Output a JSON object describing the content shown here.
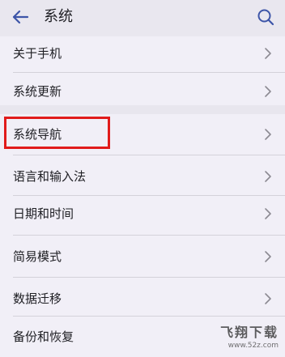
{
  "header": {
    "title": "系统",
    "back_icon": "back-arrow-icon",
    "search_icon": "search-icon",
    "accent_color": "#3d55a8"
  },
  "menu": {
    "groups": [
      {
        "items": [
          {
            "label": "关于手机",
            "icon": "chevron-right-icon"
          },
          {
            "label": "系统更新",
            "icon": "chevron-right-icon"
          }
        ]
      },
      {
        "items": [
          {
            "label": "系统导航",
            "icon": "chevron-right-icon",
            "highlighted": true
          },
          {
            "label": "语言和输入法",
            "icon": "chevron-right-icon"
          },
          {
            "label": "日期和时间",
            "icon": "chevron-right-icon"
          },
          {
            "label": "简易模式",
            "icon": "chevron-right-icon"
          },
          {
            "label": "数据迁移",
            "icon": "chevron-right-icon"
          },
          {
            "label": "备份和恢复",
            "icon": "chevron-right-icon"
          }
        ]
      }
    ]
  },
  "annotation": {
    "highlight_color": "#e11b1b"
  },
  "watermark": {
    "main": "飞翔下载",
    "sub": "www.52z.com"
  }
}
